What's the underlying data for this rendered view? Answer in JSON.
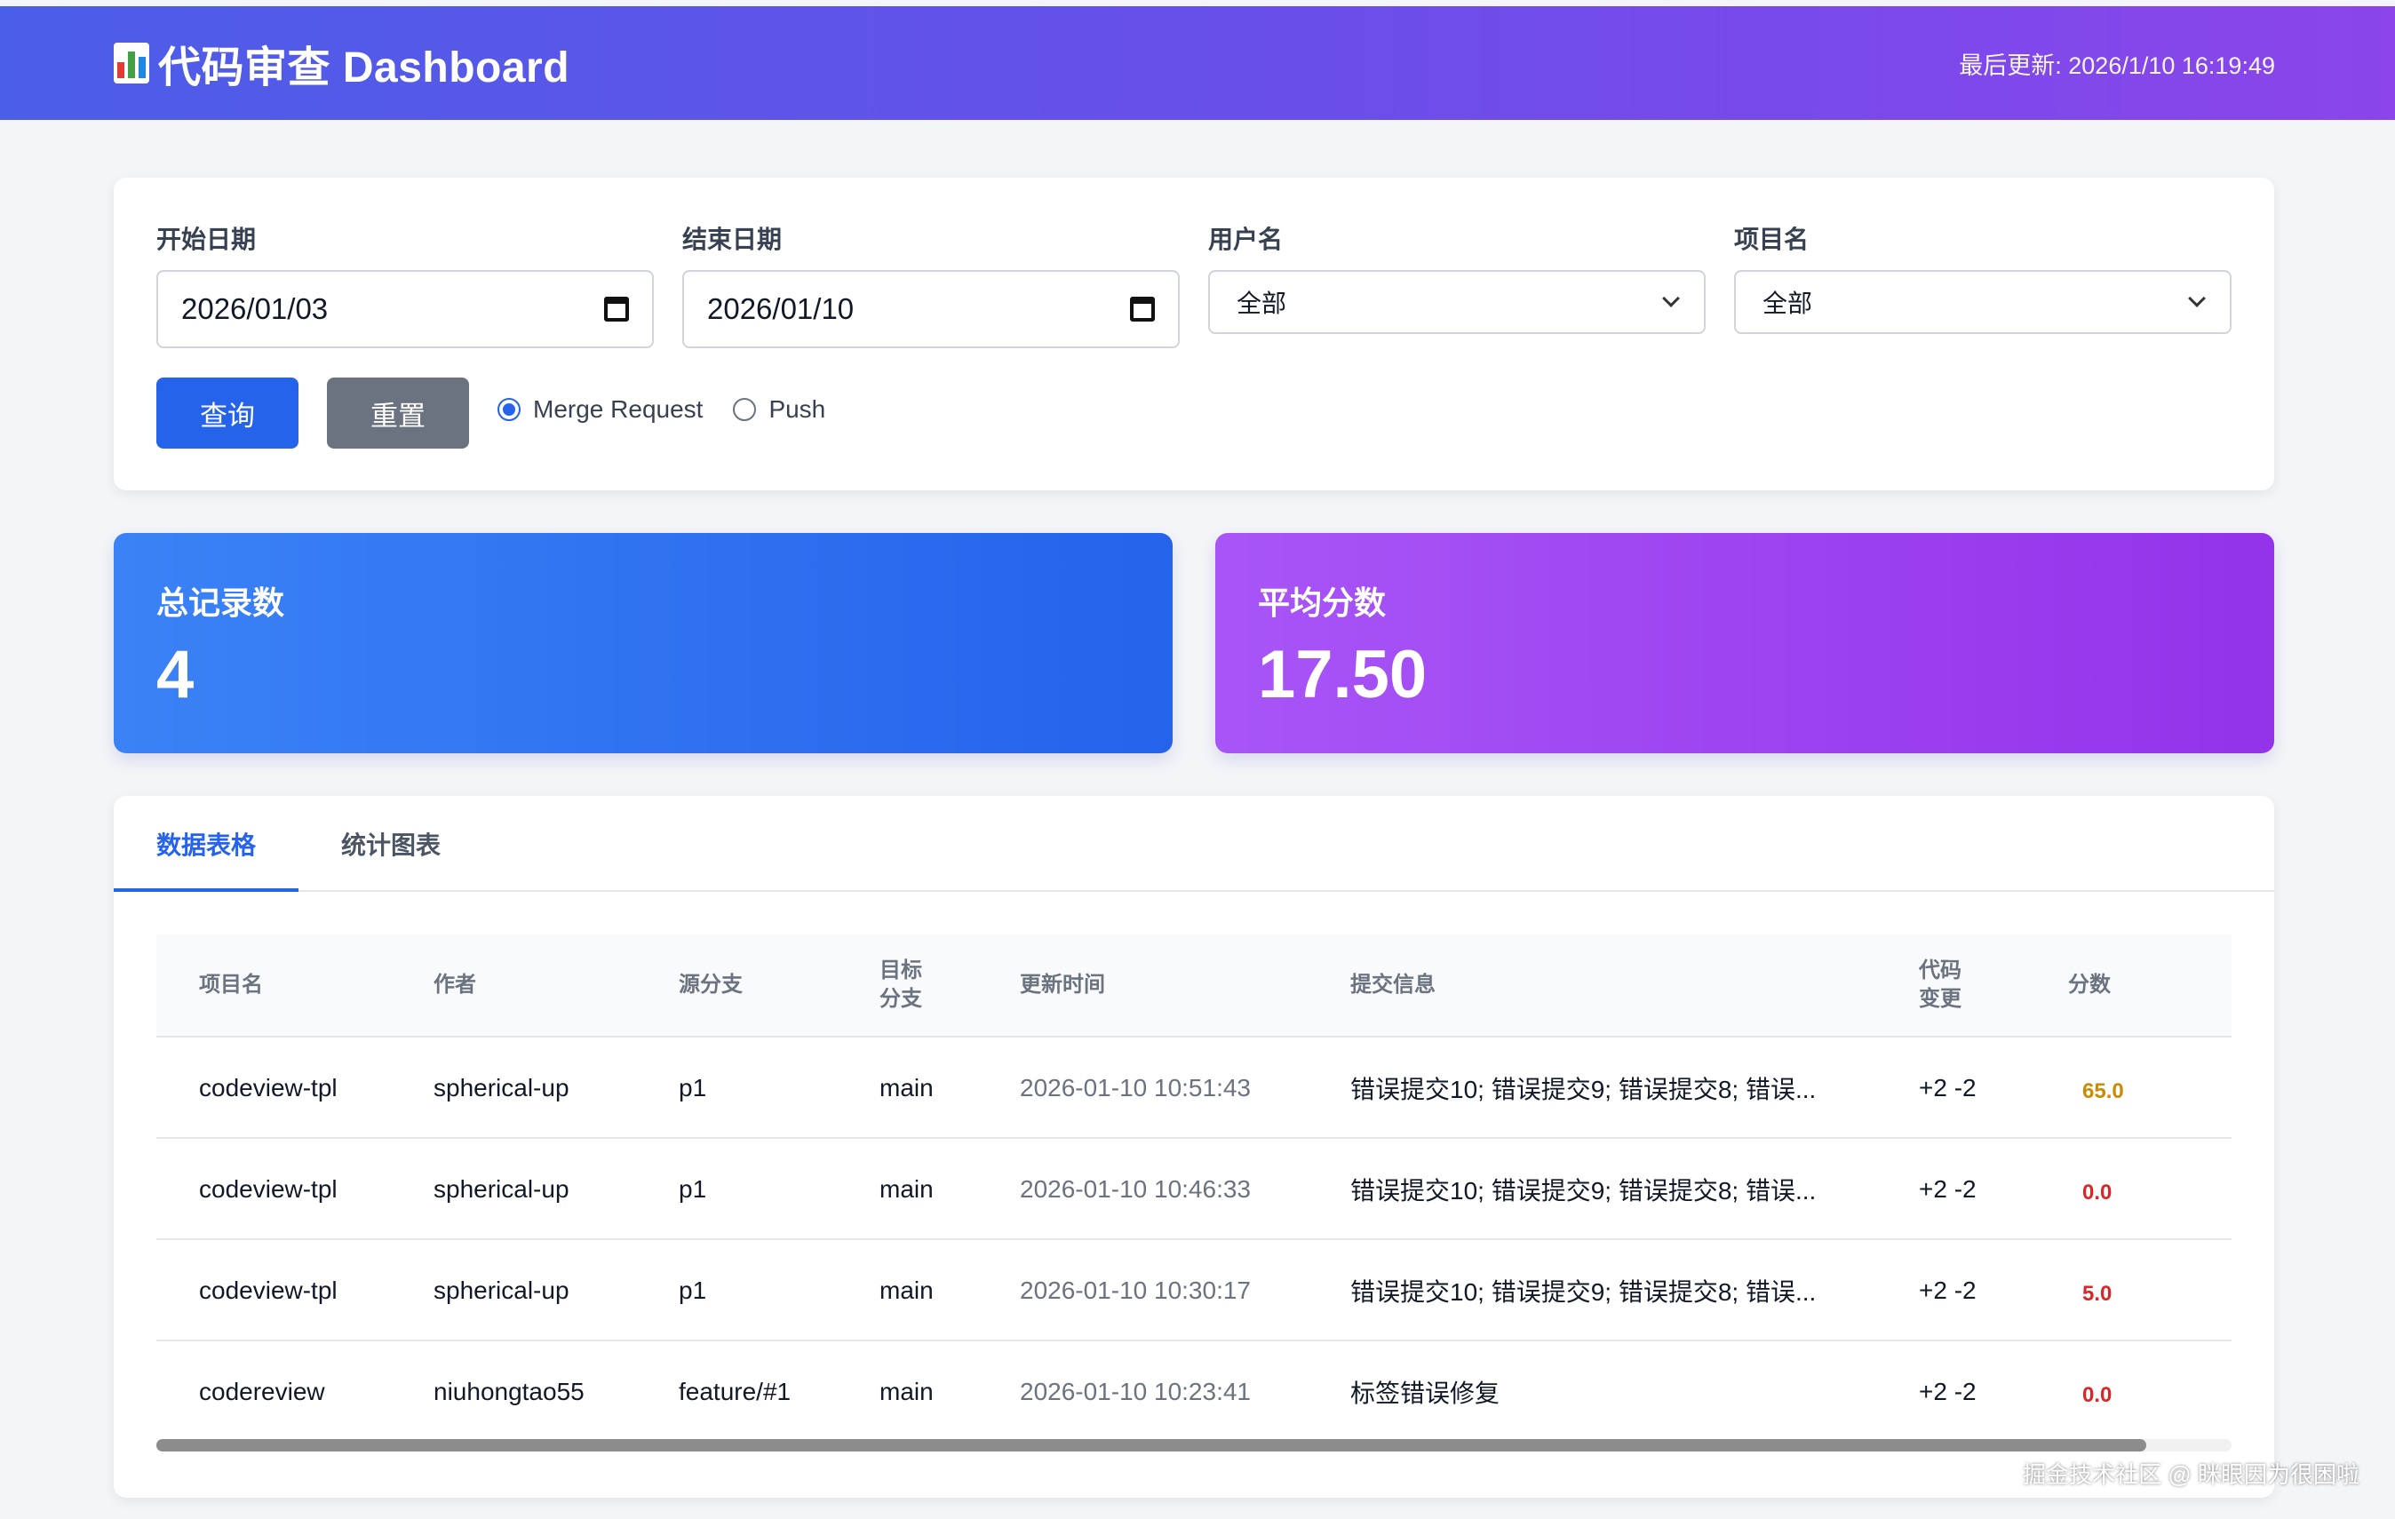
{
  "header": {
    "title": "代码审查 Dashboard",
    "updated": "最后更新: 2026/1/10 16:19:49"
  },
  "filters": {
    "start_label": "开始日期",
    "start_value": "2026/01/03",
    "end_label": "结束日期",
    "end_value": "2026/01/10",
    "user_label": "用户名",
    "user_value": "全部",
    "project_label": "项目名",
    "project_value": "全部",
    "query_label": "查询",
    "reset_label": "重置",
    "radio_mr": "Merge Request",
    "radio_push": "Push",
    "selected_mode": "Merge Request"
  },
  "stats": {
    "total_label": "总记录数",
    "total_value": "4",
    "avg_label": "平均分数",
    "avg_value": "17.50"
  },
  "tabs": [
    "数据表格",
    "统计图表"
  ],
  "table": {
    "headers": {
      "project": "项目名",
      "author": "作者",
      "source": "源分支",
      "target_l1": "目标",
      "target_l2": "分支",
      "time": "更新时间",
      "message": "提交信息",
      "change_l1": "代码",
      "change_l2": "变更",
      "score": "分数"
    },
    "rows": [
      {
        "project": "codeview-tpl",
        "author": "spherical-up",
        "source": "p1",
        "target": "main",
        "time": "2026-01-10 10:51:43",
        "message": "错误提交10; 错误提交9; 错误提交8; 错误...",
        "change": "+2 -2",
        "score": "65.0"
      },
      {
        "project": "codeview-tpl",
        "author": "spherical-up",
        "source": "p1",
        "target": "main",
        "time": "2026-01-10 10:46:33",
        "message": "错误提交10; 错误提交9; 错误提交8; 错误...",
        "change": "+2 -2",
        "score": "0.0"
      },
      {
        "project": "codeview-tpl",
        "author": "spherical-up",
        "source": "p1",
        "target": "main",
        "time": "2026-01-10 10:30:17",
        "message": "错误提交10; 错误提交9; 错误提交8; 错误...",
        "change": "+2 -2",
        "score": "5.0"
      },
      {
        "project": "codereview",
        "author": "niuhongtao55",
        "source": "feature/#1",
        "target": "main",
        "time": "2026-01-10 10:23:41",
        "message": "标签错误修复",
        "change": "+2 -2",
        "score": "0.0"
      }
    ]
  },
  "watermark": "掘金技术社区 @ 眯眼因为很困啦",
  "colors": {
    "primary": "#2563eb",
    "gradient_start": "#4b5ee8",
    "gradient_end": "#8b45ea",
    "score_warn": "#ca8a04",
    "score_bad": "#dc2626"
  }
}
